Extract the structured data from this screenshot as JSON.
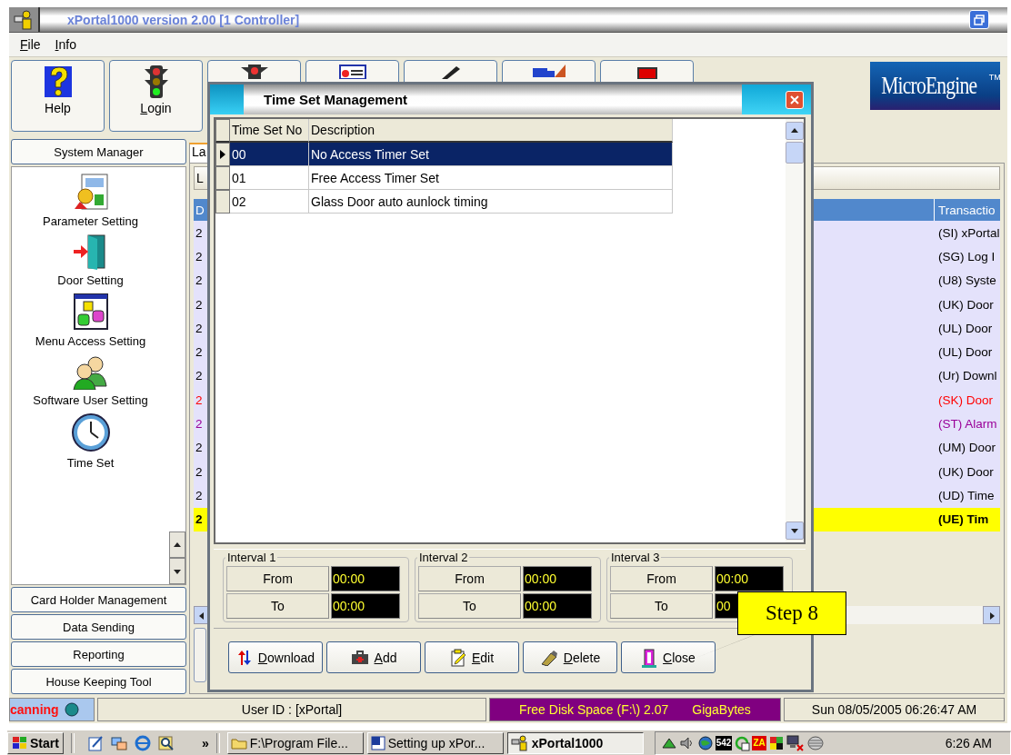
{
  "window": {
    "title": "xPortal1000 version 2.00 [1 Controller]"
  },
  "menu": [
    {
      "label": "File"
    },
    {
      "label": "Info"
    }
  ],
  "toolbar": [
    {
      "kind": "help",
      "label": "Help"
    },
    {
      "kind": "login",
      "label": "Login"
    },
    {
      "kind": "alarm"
    },
    {
      "kind": "card"
    },
    {
      "kind": "pen"
    },
    {
      "kind": "truck"
    },
    {
      "kind": "stop"
    }
  ],
  "logo": {
    "text": "MicroEngine",
    "mark": "TM"
  },
  "sidebar": {
    "header": "System Manager",
    "items": [
      {
        "kind": "parameter",
        "label": "Parameter Setting"
      },
      {
        "kind": "door",
        "label": "Door Setting"
      },
      {
        "kind": "menu",
        "label": "Menu Access Setting"
      },
      {
        "kind": "users",
        "label": "Software User Setting"
      },
      {
        "kind": "clock",
        "label": "Time Set"
      }
    ],
    "sections": [
      "Card Holder Management",
      "Data Sending",
      "Reporting",
      "House Keeping Tool"
    ]
  },
  "tab": {
    "label": "La"
  },
  "panel_button": {
    "label": "L"
  },
  "log": {
    "columns": [
      "D",
      "Transactio"
    ],
    "rows": [
      {
        "cells": [
          "2",
          "(SI) xPortal"
        ],
        "color": "#000000",
        "highlighted": false
      },
      {
        "cells": [
          "2",
          "(SG) Log I"
        ],
        "color": "#000000",
        "highlighted": false
      },
      {
        "cells": [
          "2",
          "(U8) Syste"
        ],
        "color": "#000000",
        "highlighted": false
      },
      {
        "cells": [
          "2",
          "(UK) Door"
        ],
        "color": "#000000",
        "highlighted": false
      },
      {
        "cells": [
          "2",
          "(UL) Door"
        ],
        "color": "#000000",
        "highlighted": false
      },
      {
        "cells": [
          "2",
          "(UL) Door"
        ],
        "color": "#000000",
        "highlighted": false
      },
      {
        "cells": [
          "2",
          "(Ur) Downl"
        ],
        "color": "#000000",
        "highlighted": false
      },
      {
        "cells": [
          "2",
          "(SK) Door"
        ],
        "color": "#ff0000",
        "highlighted": false
      },
      {
        "cells": [
          "2",
          "(ST) Alarm"
        ],
        "color": "#990099",
        "highlighted": false
      },
      {
        "cells": [
          "2",
          "(UM) Door"
        ],
        "color": "#000000",
        "highlighted": false
      },
      {
        "cells": [
          "2",
          "(UK) Door"
        ],
        "color": "#000000",
        "highlighted": false
      },
      {
        "cells": [
          "2",
          "(UD) Time"
        ],
        "color": "#000000",
        "highlighted": false
      },
      {
        "cells": [
          "2",
          "(UE) Tim"
        ],
        "color": "#000000",
        "highlighted": true
      }
    ]
  },
  "dialog": {
    "title": "Time Set Management",
    "columns": [
      "Time Set No",
      "Description"
    ],
    "rows": [
      {
        "no": "00",
        "description": "No Access Timer Set",
        "selected": true
      },
      {
        "no": "01",
        "description": "Free Access Timer Set",
        "selected": false
      },
      {
        "no": "02",
        "description": "Glass Door auto aunlock timing",
        "selected": false
      }
    ],
    "intervals": [
      {
        "title": "Interval 1",
        "from_label": "From",
        "from": "00:00",
        "to_label": "To",
        "to": "00:00"
      },
      {
        "title": "Interval 2",
        "from_label": "From",
        "from": "00:00",
        "to_label": "To",
        "to": "00:00"
      },
      {
        "title": "Interval 3",
        "from_label": "From",
        "from": "00:00",
        "to_label": "To",
        "to": "00"
      }
    ],
    "buttons": [
      {
        "kind": "download",
        "label": "Download"
      },
      {
        "kind": "add",
        "label": "Add"
      },
      {
        "kind": "edit",
        "label": "Edit"
      },
      {
        "kind": "delete",
        "label": "Delete"
      },
      {
        "kind": "close",
        "label": "Close"
      }
    ]
  },
  "callout": {
    "text": "Step 8"
  },
  "status_bar": {
    "scanning": "canning",
    "user": "User ID : [xPortal]",
    "disk": "Free Disk Space (F:\\) 2.07",
    "disk_unit": "GigaBytes",
    "datetime": "Sun 08/05/2005 06:26:47 AM"
  },
  "taskbar": {
    "start": "Start",
    "quick_launch": [
      {
        "kind": "note"
      },
      {
        "kind": "sync"
      },
      {
        "kind": "browser"
      },
      {
        "kind": "search"
      }
    ],
    "chevron": "»",
    "tasks": [
      {
        "kind": "folder",
        "label": "F:\\Program File...",
        "selected": false
      },
      {
        "kind": "word",
        "label": "Setting up xPor...",
        "selected": false
      },
      {
        "kind": "app",
        "label": "xPortal1000",
        "selected": true
      }
    ],
    "tray": [
      {
        "kind": "network"
      },
      {
        "kind": "speaker"
      },
      {
        "kind": "globe"
      },
      {
        "kind": "counter",
        "text": "542"
      },
      {
        "kind": "refresh"
      },
      {
        "kind": "za",
        "text": "ZA"
      },
      {
        "kind": "flag"
      },
      {
        "kind": "pc"
      },
      {
        "kind": "disk"
      }
    ],
    "clock": "6:26 AM"
  }
}
